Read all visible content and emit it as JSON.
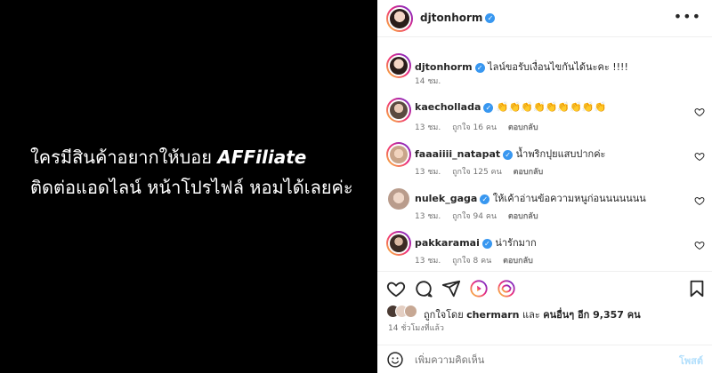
{
  "media": {
    "line1": "ใครมีสินค้าอยากให้บอย",
    "brand": "AFFiliate",
    "line2": "ติดต่อแอดไลน์ หน้าโปรไฟล์ หอมได้เลยค่ะ"
  },
  "header": {
    "username": "djtonhorm",
    "verified": true
  },
  "caption": {
    "username": "djtonhorm",
    "text": "ไลน์ขอรับเงื่อนไขกันได้นะคะ !!!!",
    "time": "14 ชม."
  },
  "comments": [
    {
      "username": "kaechollada",
      "text": "👏👏👏👏👏👏👏👏👏",
      "time": "13 ชม.",
      "likes": "ถูกใจ 16 คน",
      "reply": "ตอบกลับ"
    },
    {
      "username": "faaaiiii_natapat",
      "text": "น้ำพริกปุยแสบปากค่ะ",
      "time": "13 ชม.",
      "likes": "ถูกใจ 125 คน",
      "reply": "ตอบกลับ"
    },
    {
      "username": "nulek_gaga",
      "text": "ให้เค้าอ่านข้อความหนูก่อนนนนนนน",
      "time": "13 ชม.",
      "likes": "ถูกใจ 94 คน",
      "reply": "ตอบกลับ"
    },
    {
      "username": "pakkaramai",
      "text": "น่ารักมาก",
      "time": "13 ชม.",
      "likes": "ถูกใจ 8 คน",
      "reply": "ตอบกลับ"
    }
  ],
  "likes_line": {
    "prefix": "ถูกใจโดย",
    "user": "chermarn",
    "middle": "และ",
    "others": "คนอื่นๆ อีก 9,357 คน"
  },
  "post_time": "14 ชั่วโมงที่แล้ว",
  "add_comment": {
    "placeholder": "เพิ่มความคิดเห็น",
    "post_label": "โพสต์"
  },
  "colors": {
    "verified": "#3897f0",
    "post_disabled": "#b2dffc"
  },
  "icons": [
    "more-icon",
    "verified-icon",
    "heart-icon",
    "comment-icon",
    "share-icon",
    "reels-icon",
    "remix-icon",
    "bookmark-icon",
    "emoji-icon"
  ]
}
